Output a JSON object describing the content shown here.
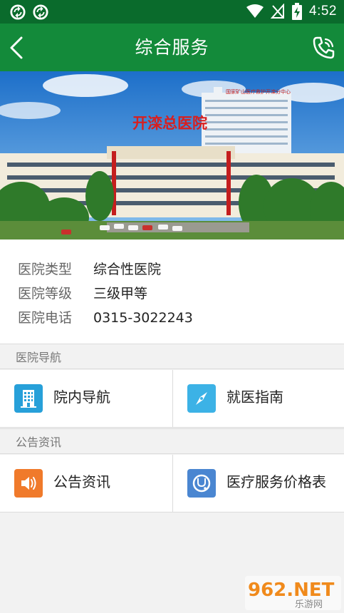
{
  "status_bar": {
    "time": "4:52",
    "icons": [
      "sync-icon",
      "sync-icon",
      "wifi-icon",
      "no-signal-icon",
      "battery-charging-icon"
    ]
  },
  "header": {
    "title": "综合服务",
    "back_icon": "chevron-left-icon",
    "phone_icon": "phone-call-icon"
  },
  "banner": {
    "sign_text": "开滦总医院",
    "roof_sign_text": "国家矿山医疗救护开滦分中心"
  },
  "hospital_info": {
    "type_label": "医院类型",
    "type_value": "综合性医院",
    "level_label": "医院等级",
    "level_value": "三级甲等",
    "phone_label": "医院电话",
    "phone_value": "0315-3022243"
  },
  "sections": {
    "nav_title": "医院导航",
    "inner_nav_label": "院内导航",
    "guide_label": "就医指南",
    "news_title": "公告资讯",
    "announce_label": "公告资讯",
    "price_label": "医疗服务价格表"
  },
  "watermark": {
    "brand": "962.NET",
    "sub": "乐游网"
  },
  "colors": {
    "status_bar": "#0a6b2c",
    "header": "#138a3a",
    "tile_blue": "#27a0d9",
    "tile_sky": "#3cb2e6",
    "tile_orange": "#f07a2b",
    "tile_steel": "#4a86d1"
  }
}
